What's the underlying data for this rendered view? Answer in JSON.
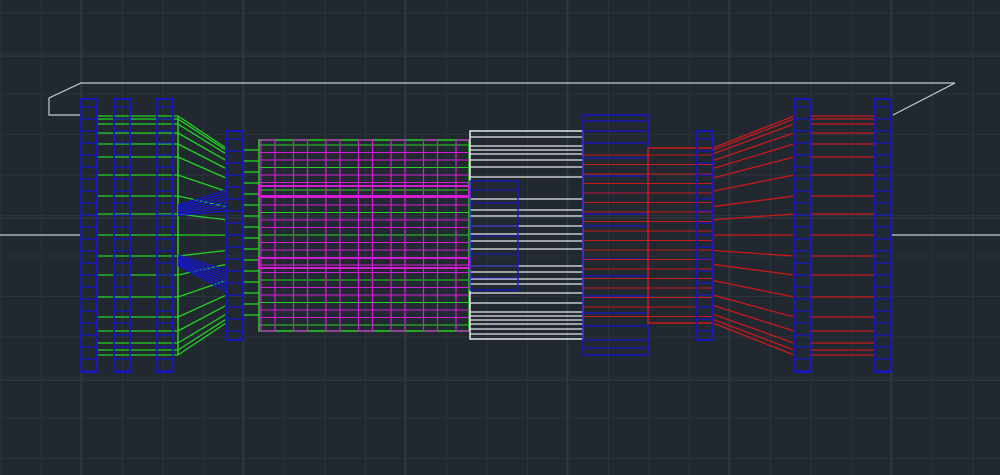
{
  "colors": {
    "background": "#212830",
    "grid_minor": "#2a323b",
    "grid_major": "#343d47",
    "outline": "#c8ccd0",
    "blue": "#1616c8",
    "green": "#22d322",
    "magenta": "#d31ed3",
    "white": "#e6e8ea",
    "red": "#c81a1a"
  }
}
